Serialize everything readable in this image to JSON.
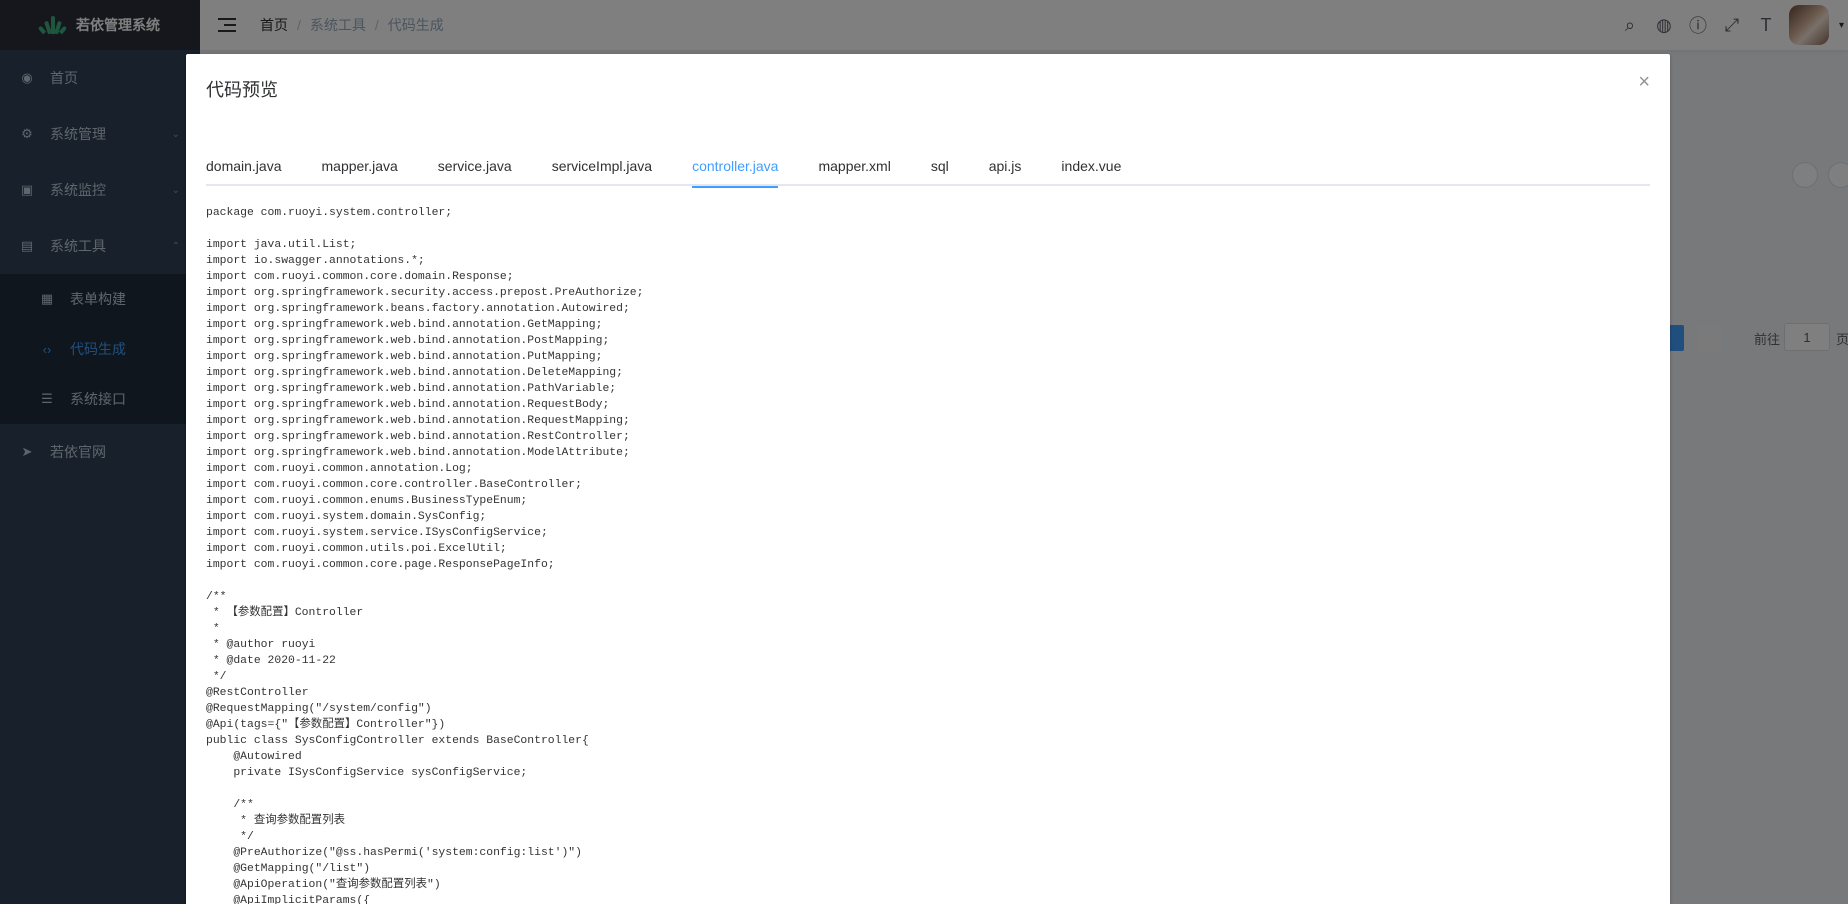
{
  "app": {
    "title": "若依管理系统"
  },
  "sidebar": {
    "items": [
      {
        "label": "首页",
        "icon": "dashboard-icon"
      },
      {
        "label": "系统管理",
        "icon": "gear-icon"
      },
      {
        "label": "系统监控",
        "icon": "monitor-icon"
      },
      {
        "label": "系统工具",
        "icon": "toolbox-icon"
      }
    ],
    "tool_submenu": [
      {
        "label": "表单构建",
        "icon": "form-icon"
      },
      {
        "label": "代码生成",
        "icon": "code-icon"
      },
      {
        "label": "系统接口",
        "icon": "sliders-icon"
      }
    ],
    "external": {
      "label": "若依官网",
      "icon": "send-icon"
    }
  },
  "navbar": {
    "breadcrumb": [
      "首页",
      "系统工具",
      "代码生成"
    ],
    "separator": "/"
  },
  "background": {
    "pager_prefix": "前往",
    "pager_page": "1",
    "pager_suffix": "页"
  },
  "dialog": {
    "title": "代码预览",
    "close": "×",
    "tabs": [
      "domain.java",
      "mapper.java",
      "service.java",
      "serviceImpl.java",
      "controller.java",
      "mapper.xml",
      "sql",
      "api.js",
      "index.vue"
    ],
    "active_tab": "controller.java",
    "code": "package com.ruoyi.system.controller;\n\nimport java.util.List;\nimport io.swagger.annotations.*;\nimport com.ruoyi.common.core.domain.Response;\nimport org.springframework.security.access.prepost.PreAuthorize;\nimport org.springframework.beans.factory.annotation.Autowired;\nimport org.springframework.web.bind.annotation.GetMapping;\nimport org.springframework.web.bind.annotation.PostMapping;\nimport org.springframework.web.bind.annotation.PutMapping;\nimport org.springframework.web.bind.annotation.DeleteMapping;\nimport org.springframework.web.bind.annotation.PathVariable;\nimport org.springframework.web.bind.annotation.RequestBody;\nimport org.springframework.web.bind.annotation.RequestMapping;\nimport org.springframework.web.bind.annotation.RestController;\nimport org.springframework.web.bind.annotation.ModelAttribute;\nimport com.ruoyi.common.annotation.Log;\nimport com.ruoyi.common.core.controller.BaseController;\nimport com.ruoyi.common.enums.BusinessTypeEnum;\nimport com.ruoyi.system.domain.SysConfig;\nimport com.ruoyi.system.service.ISysConfigService;\nimport com.ruoyi.common.utils.poi.ExcelUtil;\nimport com.ruoyi.common.core.page.ResponsePageInfo;\n\n/**\n * 【参数配置】Controller\n *\n * @author ruoyi\n * @date 2020-11-22\n */\n@RestController\n@RequestMapping(\"/system/config\")\n@Api(tags={\"【参数配置】Controller\"})\npublic class SysConfigController extends BaseController{\n    @Autowired\n    private ISysConfigService sysConfigService;\n\n    /**\n     * 查询参数配置列表\n     */\n    @PreAuthorize(\"@ss.hasPermi('system:config:list')\")\n    @GetMapping(\"/list\")\n    @ApiOperation(\"查询参数配置列表\")\n    @ApiImplicitParams({"
  }
}
